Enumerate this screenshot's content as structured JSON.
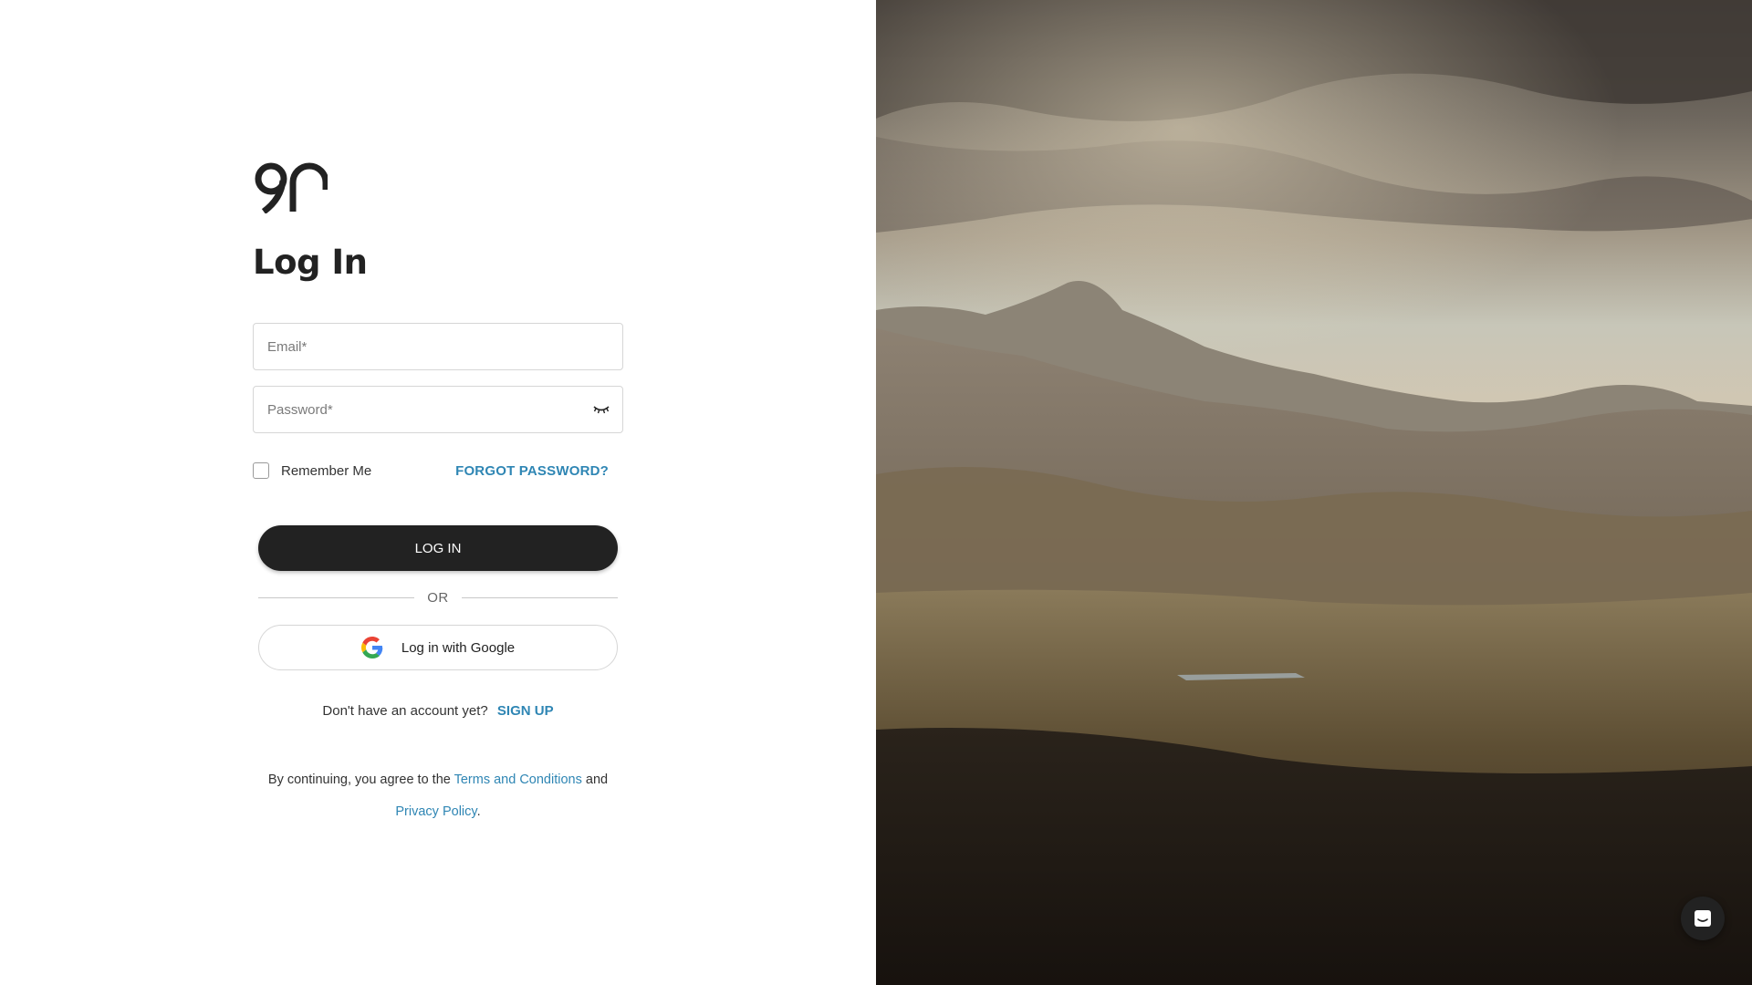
{
  "brand": {
    "logo_text": "90"
  },
  "login": {
    "heading": "Log In",
    "email_placeholder": "Email*",
    "password_placeholder": "Password*",
    "password_toggle_icon": "eye-closed-icon",
    "remember_label": "Remember Me",
    "remember_checked": false,
    "forgot_label": "FORGOT PASSWORD?",
    "submit_label": "LOG IN",
    "divider_label": "OR",
    "google_label": "Log in with Google",
    "google_icon": "google-icon"
  },
  "signup": {
    "prompt": "Don't have an account yet?",
    "link_label": "SIGN UP"
  },
  "legal": {
    "prefix": "By continuing, you agree to the",
    "terms_label": "Terms and Conditions",
    "conjunction": "and",
    "privacy_label": "Privacy Policy",
    "suffix": "."
  },
  "chat": {
    "icon": "chat-icon"
  },
  "colors": {
    "accent": "#2f86b4",
    "primary_button": "#222222",
    "border": "#d6d6d6"
  }
}
